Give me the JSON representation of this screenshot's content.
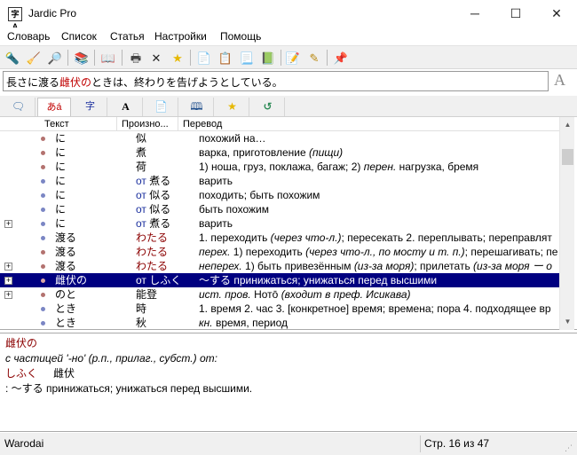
{
  "window": {
    "title": "Jardic Pro",
    "app_icon": "字A",
    "minimize": "─",
    "maximize": "☐",
    "close": "✕"
  },
  "menu": [
    "Словарь",
    "Список",
    "Статья",
    "Настройки",
    "Помощь"
  ],
  "toolbar": {
    "icons": [
      "translate-icon",
      "clean-icon",
      "search-icon",
      "stack-icon",
      "book-icon",
      "print-icon",
      "delete-icon",
      "favorite-star-icon",
      "doc-icon",
      "copy-icon",
      "doc-add-icon",
      "doc-green-icon",
      "edit-icon",
      "edit-pen-icon",
      "pin-icon"
    ],
    "glyphs": [
      "🔦",
      "🧹",
      "🔎",
      "📚",
      "📖",
      "🖶",
      "✕",
      "★",
      "📄",
      "📋",
      "📃",
      "📗",
      "📝",
      "✎",
      "📌"
    ]
  },
  "sentence": {
    "before": "長さに渡る",
    "highlight": "雌伏の",
    "after": "ときは、終わりを告げようとしている。",
    "font_button": "A"
  },
  "tabs": [
    {
      "icon": "chat-icon",
      "glyph": "🗨"
    },
    {
      "icon": "hiragana-icon",
      "glyph": "あá"
    },
    {
      "icon": "kanji-icon",
      "glyph": "字"
    },
    {
      "icon": "font-icon",
      "glyph": "A"
    },
    {
      "icon": "page-icon",
      "glyph": "📄"
    },
    {
      "icon": "dictionary-icon",
      "glyph": "🕮"
    },
    {
      "icon": "star-icon",
      "glyph": "★"
    },
    {
      "icon": "back-icon",
      "glyph": "↺"
    }
  ],
  "columns": {
    "text": "Текст",
    "reading": "Произно...",
    "translation": "Перевод"
  },
  "rows": [
    {
      "text": "に",
      "reading_pre": "",
      "reading": "似",
      "tr": "похожий на…",
      "dot": "#b3726f",
      "expand": false
    },
    {
      "text": "に",
      "reading_pre": "",
      "reading": "煮",
      "tr_italic_pre": "",
      "tr": "варка, приготовление ",
      "tr_italic": "(пищи)",
      "dot": "#b3726f",
      "expand": false
    },
    {
      "text": "に",
      "reading_pre": "",
      "reading": "荷",
      "tr": "1) ноша, груз, поклажа, багаж; 2) ",
      "tr_italic": "перен.",
      "tr_post": " нагрузка, бремя",
      "dot": "#b3726f",
      "expand": false
    },
    {
      "text": "に",
      "reading_pre": "от",
      "reading": "煮る",
      "tr": "варить",
      "dot": "#7b86c4",
      "expand": false
    },
    {
      "text": "に",
      "reading_pre": "от",
      "reading": "似る",
      "tr": "походить; быть похожим",
      "dot": "#7b86c4",
      "expand": false
    },
    {
      "text": "に",
      "reading_pre": "от",
      "reading": "似る",
      "tr": "быть похожим",
      "dot": "#7b86c4",
      "expand": false
    },
    {
      "text": "に",
      "reading_pre": "от",
      "reading": "煮る",
      "tr": "варить",
      "dot": "#7b86c4",
      "expand": true
    },
    {
      "text": "渡る",
      "reading_pre": "",
      "reading": "わたる",
      "tr": "1. переходить ",
      "tr_italic": "(через что-л.)",
      "tr_post": "; пересекать  2. переплывать; переправлят",
      "dot": "#7b86c4",
      "expand": false,
      "read_color": "#8b0000"
    },
    {
      "text": "渡る",
      "reading_pre": "",
      "reading": "わたる",
      "tr_italic_pre": "перех.",
      "tr": " 1) переходить ",
      "tr_italic": "(через что-л., по мосту и т. п.)",
      "tr_post": "; перешагивать; пе",
      "dot": "#b3726f",
      "expand": false,
      "read_color": "#8b0000"
    },
    {
      "text": "渡る",
      "reading_pre": "",
      "reading": "わたる",
      "tr_italic_pre": "неперех.",
      "tr": " 1) быть привезённым ",
      "tr_italic": "(из-за моря)",
      "tr_post": "; прилетать ",
      "tr_italic2": "(из-за моря ー о",
      "dot": "#b3726f",
      "expand": true,
      "read_color": "#8b0000"
    },
    {
      "text": "雌伏の",
      "reading_pre": "от",
      "reading": "しふく",
      "tr": "〜する принижаться; унижаться перед высшими",
      "dot": "#d9a6a3",
      "expand": true,
      "selected": true
    },
    {
      "text": "のと",
      "reading_pre": "",
      "reading": "能登",
      "tr_italic_pre": "ист. пров.",
      "tr": " Нотō ",
      "tr_italic": "(входит в преф. Исикава)",
      "dot": "#b3726f",
      "expand": true
    },
    {
      "text": "とき",
      "reading_pre": "",
      "reading": "時",
      "tr": "1. время  2. час  3. [конкретное] время; времена; пора  4. подходящее вр",
      "dot": "#7b86c4",
      "expand": false
    },
    {
      "text": "とき",
      "reading_pre": "",
      "reading": "秋",
      "tr_italic_pre": "кн.",
      "tr": " время, период",
      "dot": "#7b86c4",
      "expand": false
    }
  ],
  "detail": {
    "headword": "雌伏の",
    "note": "с частицей '-но' (р.п., прилаг., субст.) от:",
    "reading": "しふく",
    "kanji": "雌伏",
    "meaning": ": 〜する принижаться; унижаться перед высшими."
  },
  "status": {
    "dictionary": "Warodai",
    "page": "Стр. 16 из 47"
  },
  "scroll": {
    "up": "▲",
    "down": "▼"
  }
}
